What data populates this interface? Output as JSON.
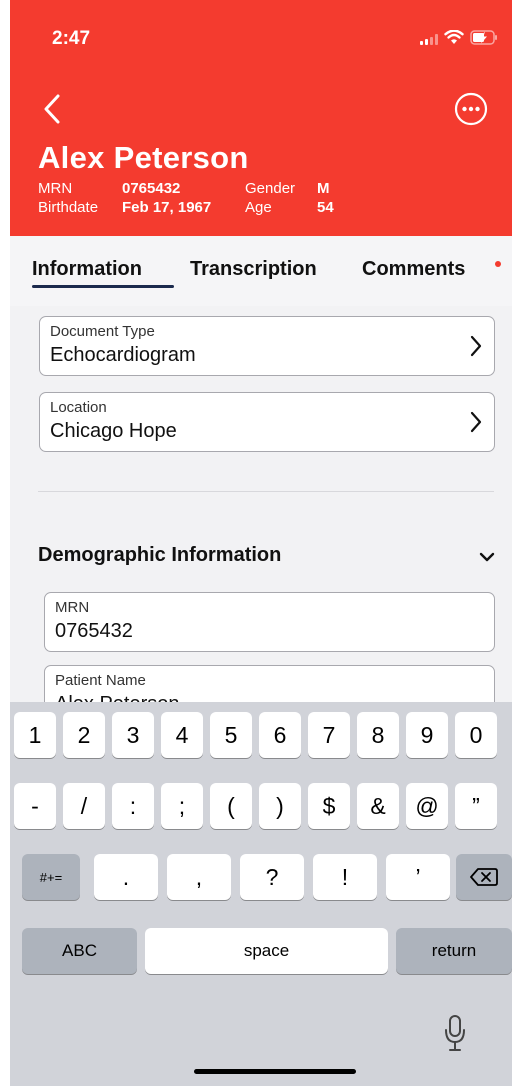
{
  "status": {
    "time": "2:47"
  },
  "patient": {
    "name": "Alex Peterson",
    "mrn_label": "MRN",
    "mrn": "0765432",
    "gender_label": "Gender",
    "gender": "M",
    "birth_label": "Birthdate",
    "birthdate": "Feb 17, 1967",
    "age_label": "Age",
    "age": "54"
  },
  "tabs": [
    {
      "label": "Information",
      "active": true
    },
    {
      "label": "Transcription",
      "active": false
    },
    {
      "label": "Comments",
      "active": false,
      "notification": true
    }
  ],
  "form": {
    "document_type": {
      "label": "Document Type",
      "value": "Echocardiogram"
    },
    "location": {
      "label": "Location",
      "value": "Chicago Hope"
    },
    "section_title": "Demographic Information",
    "mrn_field": {
      "label": "MRN",
      "value": "0765432"
    },
    "patient_name_field": {
      "label": "Patient Name",
      "value": "Alex Peterson"
    }
  },
  "keyboard": {
    "row1": [
      "1",
      "2",
      "3",
      "4",
      "5",
      "6",
      "7",
      "8",
      "9",
      "0"
    ],
    "row2": [
      "-",
      "/",
      ":",
      ";",
      "(",
      ")",
      "$",
      "&",
      "@",
      "”"
    ],
    "row3_mode": "#+=",
    "row3": [
      ".",
      ",",
      "?",
      "!",
      "’"
    ],
    "abc": "ABC",
    "space": "space",
    "return": "return"
  },
  "colors": {
    "header": "#f43b2f",
    "tab_underline": "#1b2a4d",
    "keyboard_bg": "#d1d3d9"
  }
}
